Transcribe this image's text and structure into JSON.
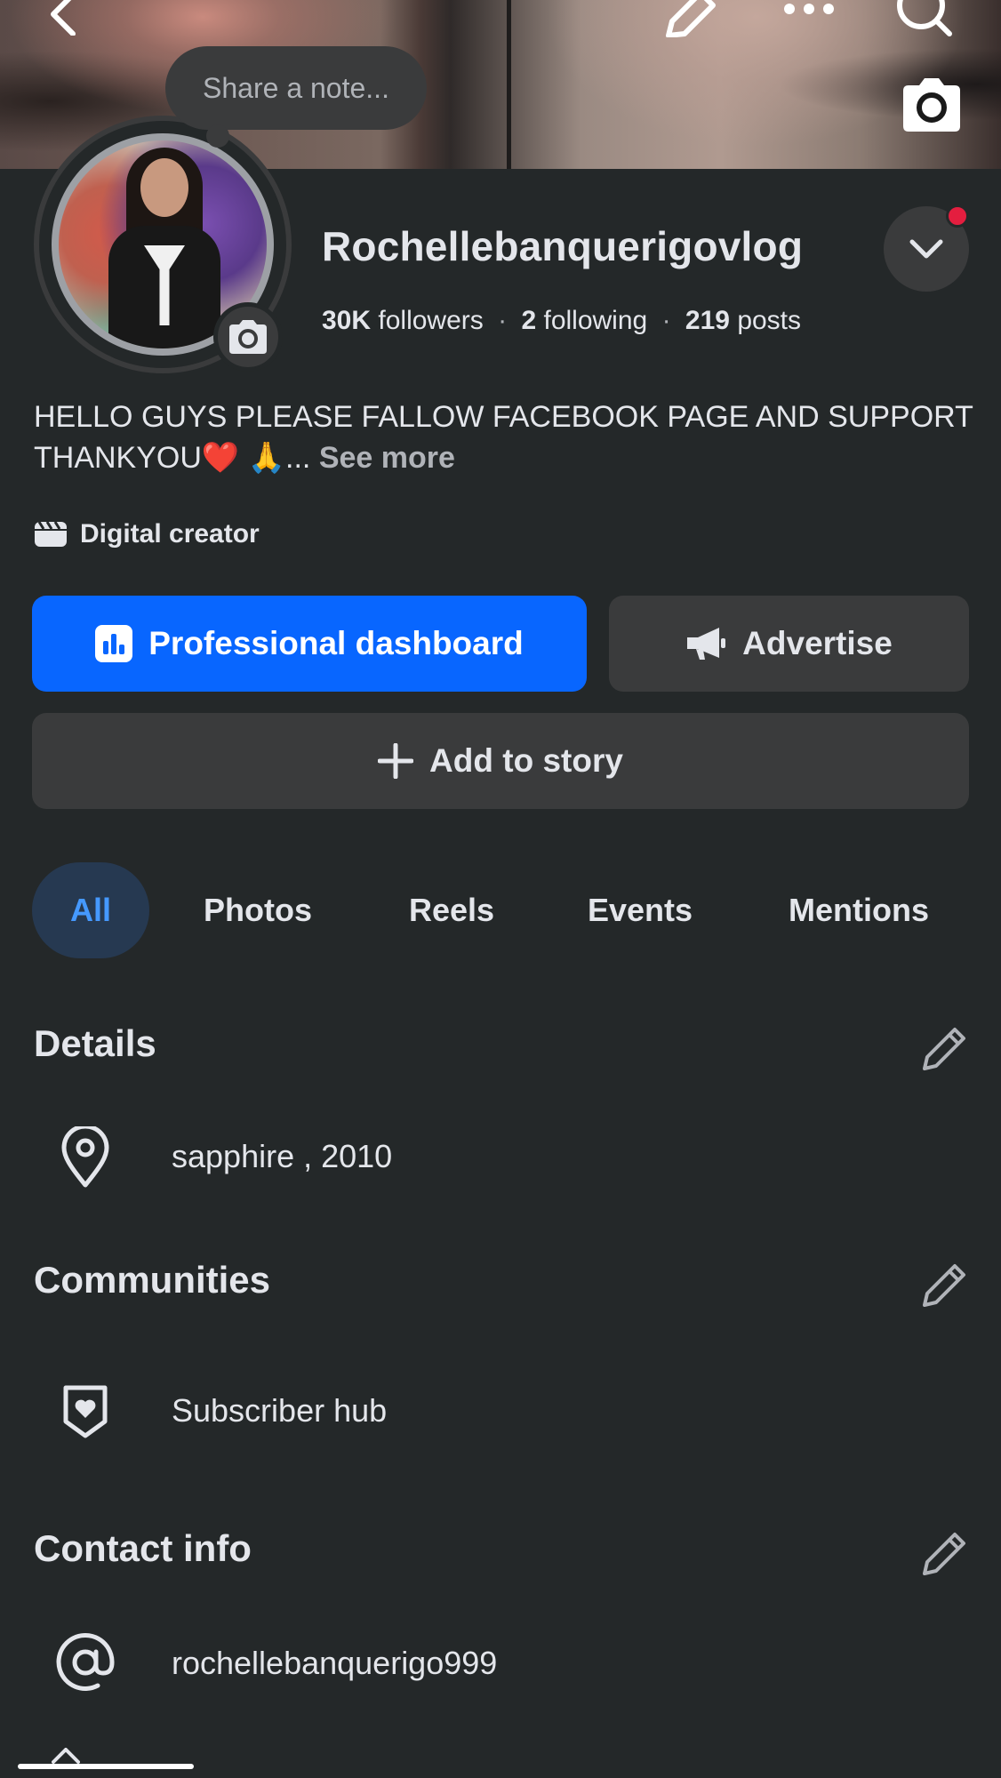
{
  "top_bar": {
    "back_icon": "chevron-left-icon",
    "edit_icon": "pencil-icon",
    "more_icon": "more-dots-icon",
    "search_icon": "search-icon",
    "cover_camera_icon": "camera-icon"
  },
  "note": {
    "placeholder": "Share a note..."
  },
  "profile": {
    "name": "Rochellebanquerigovlog",
    "followers_count": "30K",
    "followers_label": "followers",
    "following_count": "2",
    "following_label": "following",
    "posts_count": "219",
    "posts_label": "posts",
    "separator": "·",
    "bio": "HELLO GUYS PLEASE FALLOW FACEBOOK PAGE AND SUPPORT THANKYOU❤️ 🙏...",
    "see_more": "See more",
    "category": "Digital creator"
  },
  "actions": {
    "dashboard_label": "Professional dashboard",
    "advertise_label": "Advertise",
    "story_label": "Add to story"
  },
  "tabs": [
    {
      "label": "All",
      "active": true
    },
    {
      "label": "Photos",
      "active": false
    },
    {
      "label": "Reels",
      "active": false
    },
    {
      "label": "Events",
      "active": false
    },
    {
      "label": "Mentions",
      "active": false
    }
  ],
  "details": {
    "title": "Details",
    "items": [
      {
        "icon": "location-pin-icon",
        "text": "sapphire , 2010"
      }
    ]
  },
  "communities": {
    "title": "Communities",
    "items": [
      {
        "icon": "shield-heart-icon",
        "text": "Subscriber hub"
      }
    ]
  },
  "contact": {
    "title": "Contact info",
    "items": [
      {
        "icon": "at-sign-icon",
        "text": "rochellebanquerigo999"
      }
    ]
  },
  "colors": {
    "background": "#242829",
    "surface": "#3a3b3c",
    "accent_blue": "#0866ff",
    "active_tab_bg": "#263951",
    "active_tab_text": "#4599ff",
    "notification_red": "#e41e3f"
  }
}
